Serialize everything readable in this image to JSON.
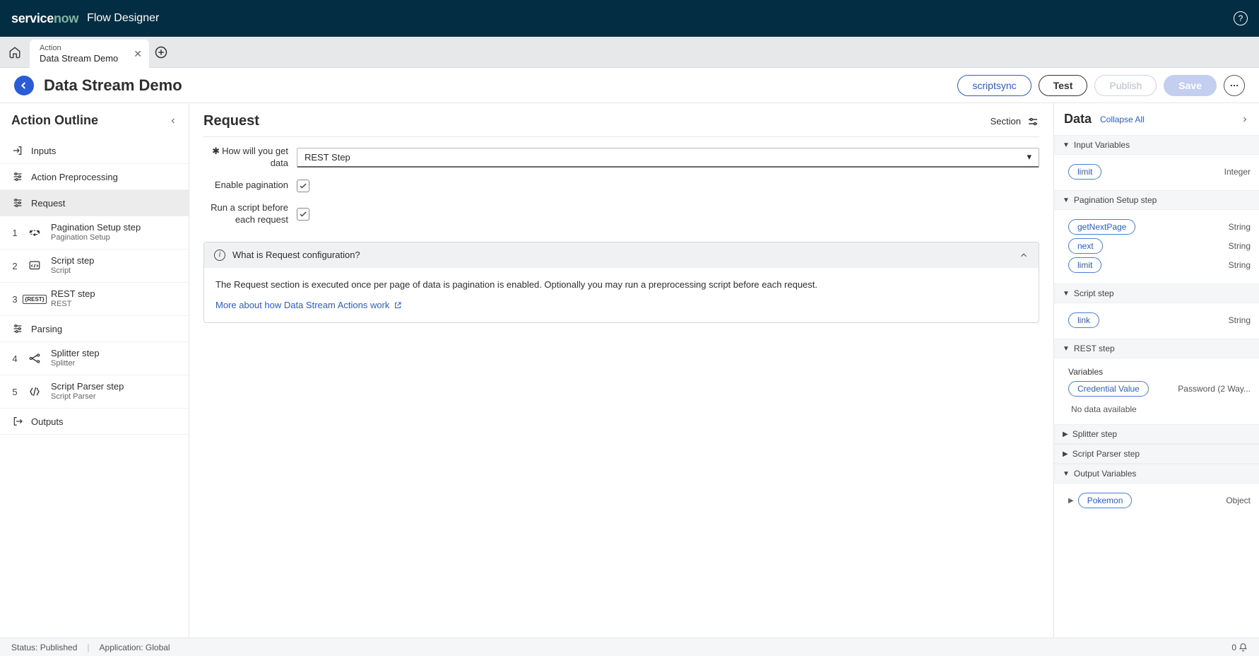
{
  "brand": {
    "left": "service",
    "right": "now",
    "app": "Flow Designer"
  },
  "tab": {
    "type": "Action",
    "name": "Data Stream Demo"
  },
  "page": {
    "title": "Data Stream Demo"
  },
  "buttons": {
    "scriptsync": "scriptsync",
    "test": "Test",
    "publish": "Publish",
    "save": "Save"
  },
  "outline": {
    "title": "Action Outline",
    "inputs": "Inputs",
    "preprocessing": "Action Preprocessing",
    "request": "Request",
    "parsing": "Parsing",
    "outputs": "Outputs",
    "steps": [
      {
        "num": "1",
        "title": "Pagination Setup step",
        "sub": "Pagination Setup"
      },
      {
        "num": "2",
        "title": "Script step",
        "sub": "Script"
      },
      {
        "num": "3",
        "title": "REST step",
        "sub": "REST"
      }
    ],
    "parseSteps": [
      {
        "num": "4",
        "title": "Splitter step",
        "sub": "Splitter"
      },
      {
        "num": "5",
        "title": "Script Parser step",
        "sub": "Script Parser"
      }
    ]
  },
  "content": {
    "heading": "Request",
    "sectionLabel": "Section",
    "form": {
      "howLabel": "How will you get data",
      "howValue": "REST Step",
      "paginationLabel": "Enable pagination",
      "scriptLabel": "Run a script before each request"
    },
    "info": {
      "head": "What is Request configuration?",
      "body": "The Request section is executed once per page of data is pagination is enabled. Optionally you may run a preprocessing script before each request.",
      "link": "More about how Data Stream Actions work"
    }
  },
  "data": {
    "title": "Data",
    "collapseAll": "Collapse All",
    "inputVariables": {
      "title": "Input Variables",
      "vars": [
        {
          "name": "limit",
          "type": "Integer"
        }
      ]
    },
    "paginationStep": {
      "title": "Pagination Setup step",
      "vars": [
        {
          "name": "getNextPage",
          "type": "String"
        },
        {
          "name": "next",
          "type": "String"
        },
        {
          "name": "limit",
          "type": "String"
        }
      ]
    },
    "scriptStep": {
      "title": "Script step",
      "vars": [
        {
          "name": "link",
          "type": "String"
        }
      ]
    },
    "restStep": {
      "title": "REST step",
      "variablesLabel": "Variables",
      "vars": [
        {
          "name": "Credential Value",
          "type": "Password (2 Way..."
        }
      ],
      "noData": "No data available"
    },
    "splitterStep": {
      "title": "Splitter step"
    },
    "scriptParserStep": {
      "title": "Script Parser step"
    },
    "outputVariables": {
      "title": "Output Variables",
      "vars": [
        {
          "name": "Pokemon",
          "type": "Object"
        }
      ]
    }
  },
  "status": {
    "status": "Status: Published",
    "application": "Application: Global",
    "count": "0"
  }
}
